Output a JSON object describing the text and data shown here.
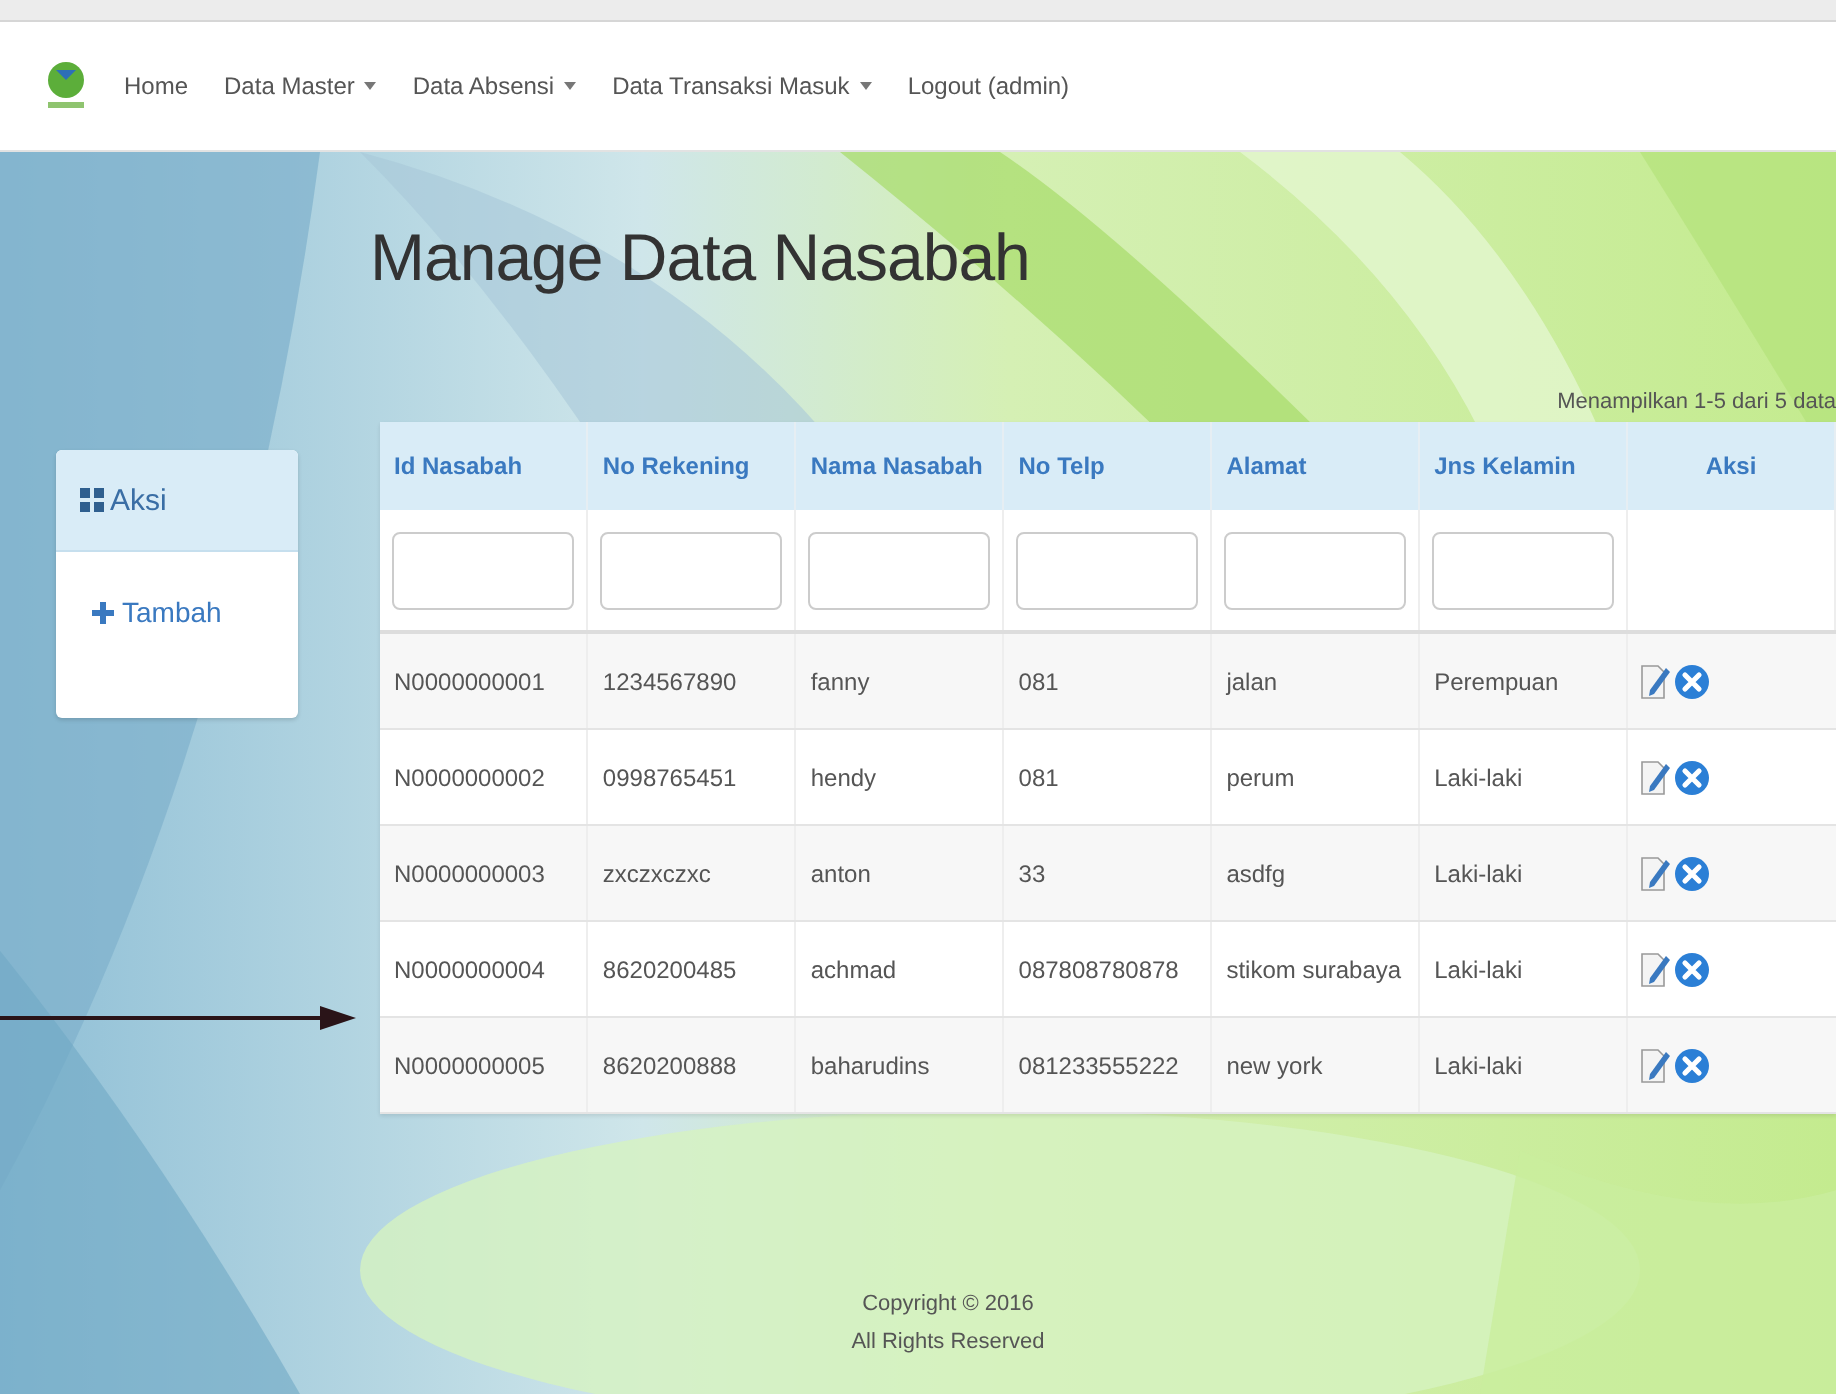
{
  "navbar": {
    "items": [
      {
        "label": "Home",
        "dropdown": false
      },
      {
        "label": "Data Master",
        "dropdown": true
      },
      {
        "label": "Data Absensi",
        "dropdown": true
      },
      {
        "label": "Data Transaksi Masuk",
        "dropdown": true
      },
      {
        "label": "Logout (admin)",
        "dropdown": false
      }
    ]
  },
  "page_title": "Manage Data Nasabah",
  "sidebar": {
    "title": "Aksi",
    "items": [
      {
        "label": "Tambah"
      }
    ]
  },
  "summary": "Menampilkan 1-5 dari 5 data",
  "table": {
    "columns": [
      {
        "label": "Id Nasabah",
        "filter": true
      },
      {
        "label": "No Rekening",
        "filter": true
      },
      {
        "label": "Nama Nasabah",
        "filter": true
      },
      {
        "label": "No Telp",
        "filter": true
      },
      {
        "label": "Alamat",
        "filter": true
      },
      {
        "label": "Jns Kelamin",
        "filter": true
      },
      {
        "label": "Aksi",
        "filter": false
      }
    ],
    "rows": [
      {
        "cells": [
          "N0000000001",
          "1234567890",
          "fanny",
          "081",
          "jalan",
          "Perempuan"
        ]
      },
      {
        "cells": [
          "N0000000002",
          "0998765451",
          "hendy",
          "081",
          "perum",
          "Laki-laki"
        ]
      },
      {
        "cells": [
          "N0000000003",
          "zxczxczxc",
          "anton",
          "33",
          "asdfg",
          "Laki-laki"
        ]
      },
      {
        "cells": [
          "N0000000004",
          "8620200485",
          "achmad",
          "087808780878",
          "stikom surabaya",
          "Laki-laki"
        ]
      },
      {
        "cells": [
          "N0000000005",
          "8620200888",
          "baharudins",
          "081233555222",
          "new york",
          "Laki-laki"
        ]
      }
    ]
  },
  "footer": {
    "lines": [
      "Copyright © 2016",
      "All Rights Reserved"
    ]
  }
}
